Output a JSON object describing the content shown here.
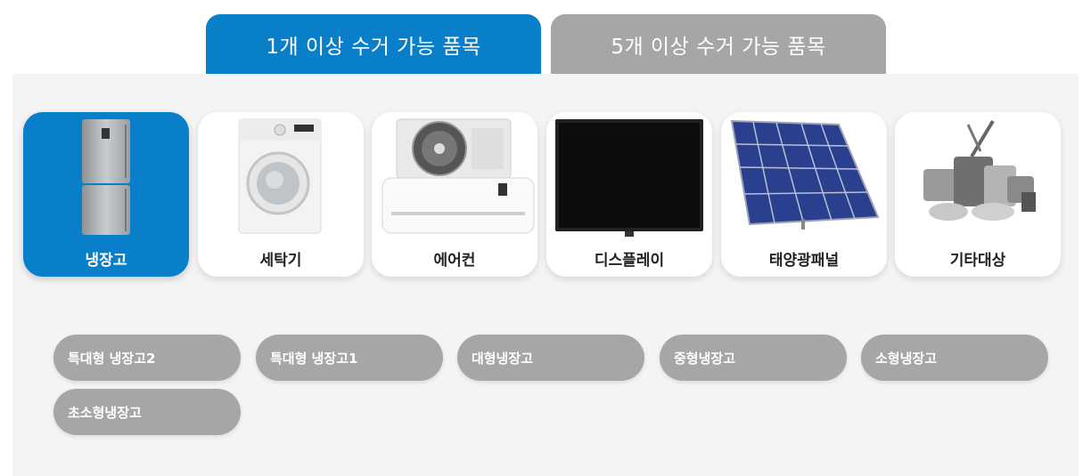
{
  "tabs": [
    {
      "label": "1개 이상 수거 가능 품목",
      "active": true
    },
    {
      "label": "5개 이상 수거 가능 품목",
      "active": false
    }
  ],
  "categories": [
    {
      "label": "냉장고",
      "icon": "refrigerator-icon",
      "selected": true
    },
    {
      "label": "세탁기",
      "icon": "washing-machine-icon",
      "selected": false
    },
    {
      "label": "에어컨",
      "icon": "air-conditioner-icon",
      "selected": false
    },
    {
      "label": "디스플레이",
      "icon": "display-icon",
      "selected": false
    },
    {
      "label": "태양광패널",
      "icon": "solar-panel-icon",
      "selected": false
    },
    {
      "label": "기타대상",
      "icon": "misc-appliances-icon",
      "selected": false
    }
  ],
  "subcategories": [
    "특대형 냉장고2",
    "특대형 냉장고1",
    "대형냉장고",
    "중형냉장고",
    "소형냉장고",
    "초소형냉장고"
  ],
  "colors": {
    "accent": "#0a7fc9",
    "inactive": "#a6a6a6",
    "panel": "#f4f4f4"
  }
}
